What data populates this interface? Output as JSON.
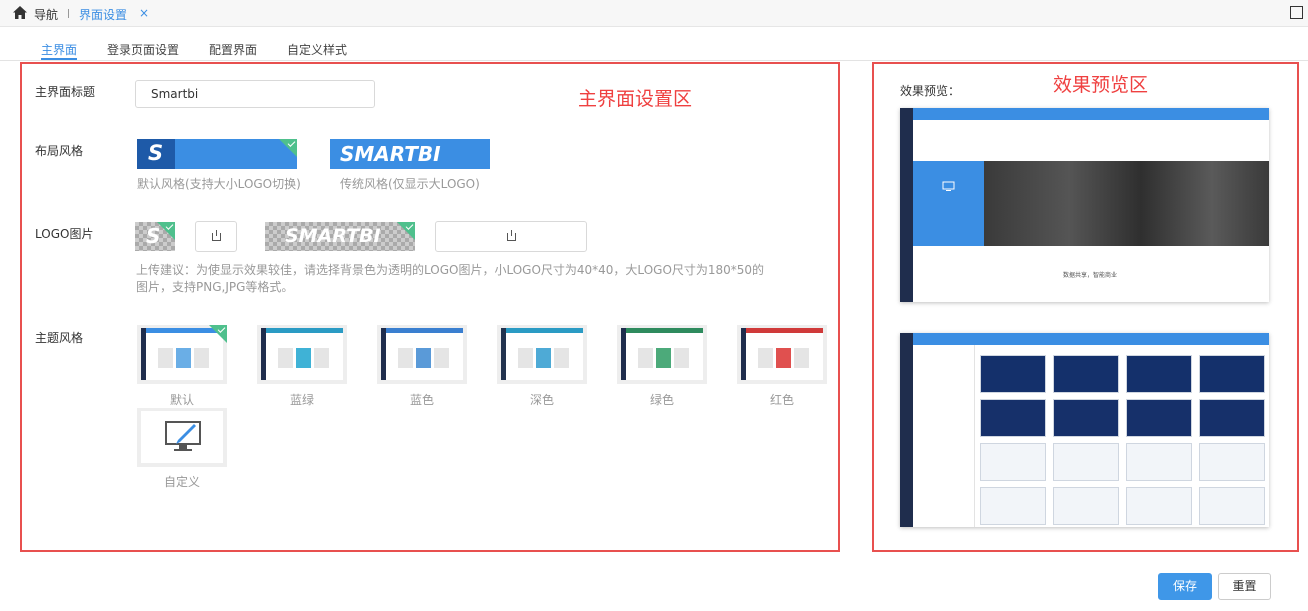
{
  "topbar": {
    "nav": "导航",
    "tab": "界面设置",
    "close": "×"
  },
  "subtabs": [
    "主界面",
    "登录页面设置",
    "配置界面",
    "自定义样式"
  ],
  "left": {
    "region_title": "主界面设置区",
    "title_label": "主界面标题",
    "title_value": "Smartbi",
    "layout_label": "布局风格",
    "layout_default": "默认风格(支持大小LOGO切换)",
    "layout_classic": "传统风格(仅显示大LOGO)",
    "logo_brand": "SMARTBI",
    "logo_label": "LOGO图片",
    "hint": "上传建议：为使显示效果较佳，请选择背景色为透明的LOGO图片，小LOGO尺寸为40*40，大LOGO尺寸为180*50的图片，支持PNG,JPG等格式。",
    "theme_label": "主题风格",
    "themes": [
      {
        "name": "默认",
        "bar": "#3b8ee3",
        "side": "#1f2d4d",
        "accent": "#6aaee6"
      },
      {
        "name": "蓝绿",
        "bar": "#2a9bc4",
        "side": "#1f2d4d",
        "accent": "#3fb2d6"
      },
      {
        "name": "蓝色",
        "bar": "#3a7fd0",
        "side": "#1f2d4d",
        "accent": "#5a9ad8"
      },
      {
        "name": "深色",
        "bar": "#2a9bc4",
        "side": "#22334f",
        "accent": "#4eaad6"
      },
      {
        "name": "绿色",
        "bar": "#2e8b5e",
        "side": "#1f2d4d",
        "accent": "#4caa7a"
      },
      {
        "name": "红色",
        "bar": "#d03a3a",
        "side": "#1f2d4d",
        "accent": "#e0504f"
      }
    ],
    "custom_theme": "自定义"
  },
  "right": {
    "region_title": "效果预览区",
    "preview_label": "效果预览：",
    "preview_caption": "数据共享，智能商业"
  },
  "buttons": {
    "save": "保存",
    "reset": "重置"
  },
  "colors": {
    "accent": "#3b8ee3",
    "highlight_red": "#e8504f",
    "check": "#4fc08d"
  }
}
